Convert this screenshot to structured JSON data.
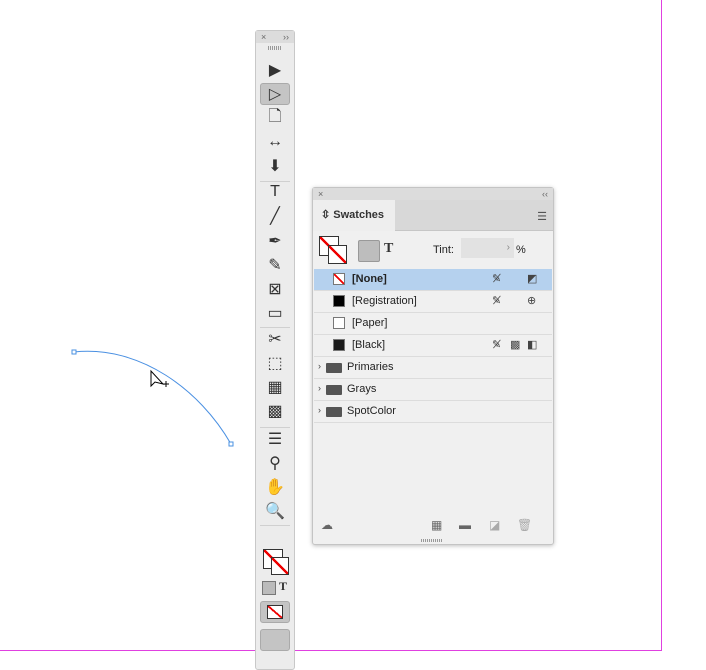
{
  "toolbar": {
    "close": "×",
    "collapse": "››",
    "tools": [
      {
        "name": "selection-tool",
        "glyph": "▶"
      },
      {
        "name": "direct-selection-tool",
        "glyph": "▷",
        "selected": true
      },
      {
        "name": "page-tool",
        "glyph": "🗋"
      },
      {
        "name": "gap-tool",
        "glyph": "↔"
      },
      {
        "name": "content-collector-tool",
        "glyph": "⬇"
      },
      {
        "name": "type-tool",
        "glyph": "T"
      },
      {
        "name": "line-tool",
        "glyph": "╱"
      },
      {
        "name": "pen-tool",
        "glyph": "✒"
      },
      {
        "name": "pencil-tool",
        "glyph": "✎"
      },
      {
        "name": "rectangle-frame-tool",
        "glyph": "⊠"
      },
      {
        "name": "rectangle-tool",
        "glyph": "▭"
      },
      {
        "name": "scissors-tool",
        "glyph": "✂"
      },
      {
        "name": "free-transform-tool",
        "glyph": "⬚"
      },
      {
        "name": "gradient-swatch-tool",
        "glyph": "▦"
      },
      {
        "name": "gradient-feather-tool",
        "glyph": "▩"
      },
      {
        "name": "note-tool",
        "glyph": "☰"
      },
      {
        "name": "eyedropper-tool",
        "glyph": "⚲"
      },
      {
        "name": "hand-tool",
        "glyph": "✋"
      },
      {
        "name": "zoom-tool",
        "glyph": "🔍"
      }
    ],
    "formatting_text": "T"
  },
  "swatches": {
    "close": "×",
    "collapse": "‹‹",
    "title": "Swatches",
    "tint_label": "Tint:",
    "tint_value": "",
    "tint_unit": "%",
    "text_icon": "T",
    "items": [
      {
        "label": "[None]",
        "color": "none",
        "selected": true
      },
      {
        "label": "[Registration]",
        "color": "#000000"
      },
      {
        "label": "[Paper]",
        "color": "#ffffff"
      },
      {
        "label": "[Black]",
        "color": "#1a1a1a"
      }
    ],
    "groups": [
      {
        "label": "Primaries"
      },
      {
        "label": "Grays"
      },
      {
        "label": "SpotColor"
      }
    ]
  }
}
